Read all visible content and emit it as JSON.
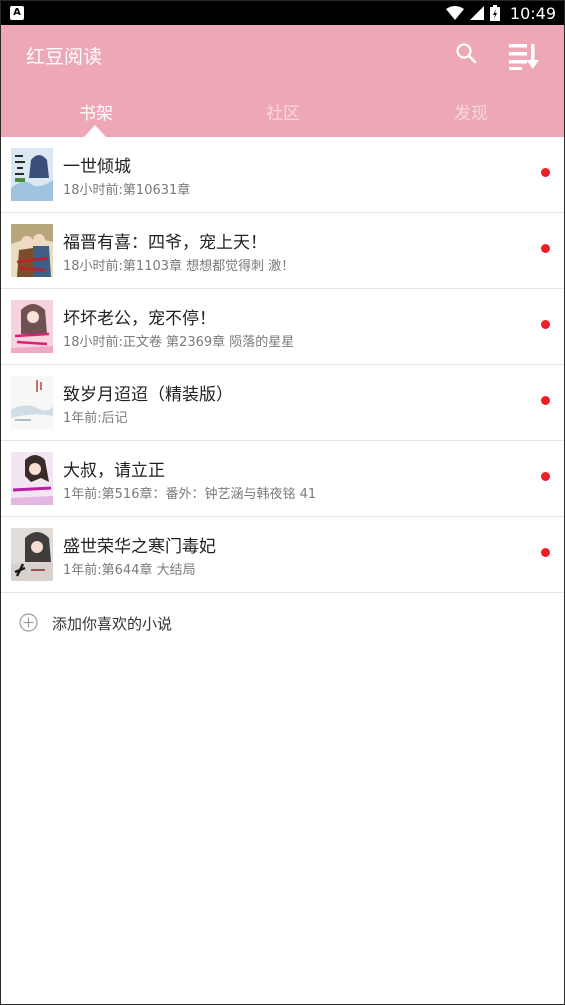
{
  "status_bar": {
    "notification_badge": "A",
    "time": "10:49"
  },
  "header": {
    "title": "红豆阅读",
    "search_icon": "search-icon",
    "sort_icon": "sort-icon",
    "accent_color": "#eea8b5"
  },
  "tabs": [
    {
      "label": "书架",
      "active": true
    },
    {
      "label": "社区",
      "active": false
    },
    {
      "label": "发现",
      "active": false
    }
  ],
  "books": [
    {
      "title": "一世倾城",
      "update": "18小时前:第10631章"
    },
    {
      "title": "福晋有喜：四爷，宠上天！",
      "update": "18小时前:第1103章 想想都觉得刺 激！"
    },
    {
      "title": "坏坏老公，宠不停！",
      "update": "18小时前:正文卷 第2369章 陨落的星星"
    },
    {
      "title": "致岁月迢迢（精装版）",
      "update": "1年前:后记"
    },
    {
      "title": "大叔，请立正",
      "update": "1年前:第516章：番外：钟艺涵与韩夜铭 41"
    },
    {
      "title": "盛世荣华之寒门毒妃",
      "update": "1年前:第644章 大结局"
    }
  ],
  "unread_color": "#ee1c25",
  "add_book": {
    "label": "添加你喜欢的小说",
    "icon": "add-circle-icon"
  }
}
